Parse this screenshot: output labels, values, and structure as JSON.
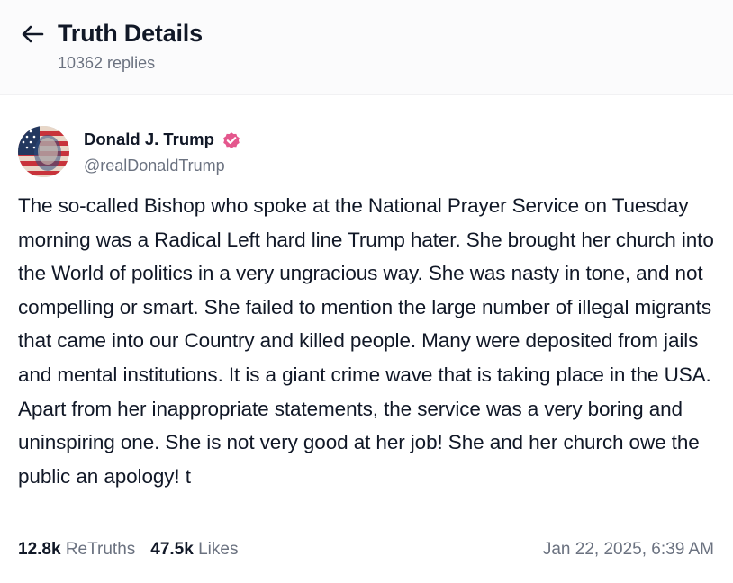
{
  "header": {
    "title": "Truth Details",
    "replies": "10362 replies",
    "back_icon": "arrow-left-icon"
  },
  "post": {
    "author": {
      "name": "Donald J. Trump",
      "handle": "@realDonaldTrump",
      "verified": true,
      "verified_color": "#e4578d"
    },
    "text": "The so-called Bishop who spoke at the National Prayer Service on Tuesday morning was a Radical Left hard line Trump hater. She brought her church into the World of politics in a very ungracious way. She was nasty in tone, and not compelling or smart. She failed to mention the large number of illegal migrants that came into our Country and killed people. Many were deposited from jails and mental institutions. It is a giant crime wave that is taking place in the USA. Apart from her inappropriate statements, the service was a very boring and uninspiring one. She is not very good at her job! She and her church owe the public an apology! t",
    "retruths_count": "12.8k",
    "retruths_label": "ReTruths",
    "likes_count": "47.5k",
    "likes_label": "Likes",
    "timestamp": "Jan 22, 2025, 6:39 AM"
  }
}
